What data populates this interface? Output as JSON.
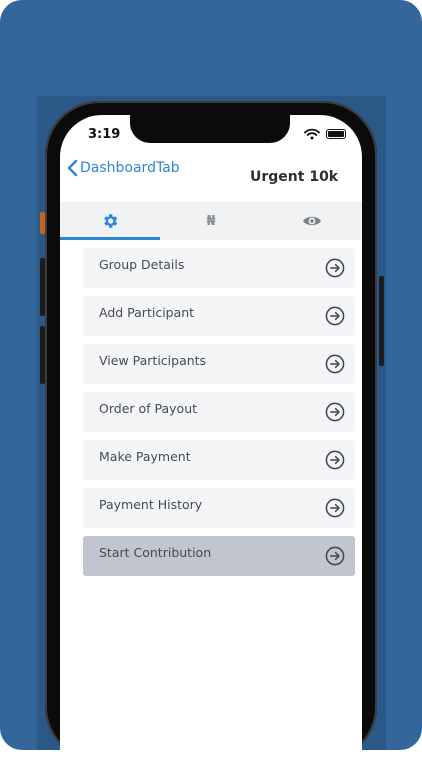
{
  "status_bar": {
    "time": "3:19"
  },
  "nav": {
    "back_label": "DashboardTab",
    "title": "Urgent 10k"
  },
  "tabs": [
    {
      "icon": "gear-icon",
      "active": true
    },
    {
      "icon": "naira-icon",
      "symbol": "₦",
      "active": false
    },
    {
      "icon": "eye-icon",
      "active": false
    }
  ],
  "menu": {
    "items": [
      {
        "label": "Group Details"
      },
      {
        "label": "Add Participant"
      },
      {
        "label": "View Participants"
      },
      {
        "label": "Order of Payout"
      },
      {
        "label": "Make Payment"
      },
      {
        "label": "Payment History"
      },
      {
        "label": "Start Contribution"
      }
    ]
  },
  "colors": {
    "background": "#33669a",
    "accent": "#2f86d6",
    "item_bg": "#f4f5f7",
    "item_active_bg": "#c1c5cf",
    "text": "#454a55"
  }
}
